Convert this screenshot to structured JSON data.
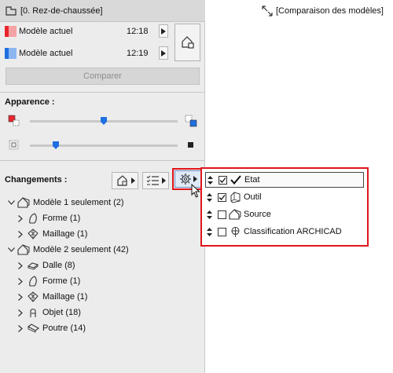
{
  "left_tab": {
    "label": "[0. Rez-de-chaussée]"
  },
  "right_tab": {
    "label": "[Comparaison des modèles]"
  },
  "models": [
    {
      "name": "Modèle actuel",
      "time": "12:18",
      "color": "#e8262c"
    },
    {
      "name": "Modèle actuel",
      "time": "12:19",
      "color": "#1f6fe0"
    }
  ],
  "compare_button": "Comparer",
  "appearance": {
    "label": "Apparence :",
    "slider1_value": 0.5,
    "slider2_value": 0.2
  },
  "changes": {
    "label": "Changements :",
    "groups": [
      {
        "label": "Modèle 1 seulement (2)",
        "items": [
          {
            "label": "Forme (1)",
            "icon": "shape-icon"
          },
          {
            "label": "Maillage (1)",
            "icon": "mesh-icon"
          }
        ]
      },
      {
        "label": "Modèle 2 seulement (42)",
        "items": [
          {
            "label": "Dalle (8)",
            "icon": "slab-icon"
          },
          {
            "label": "Forme (1)",
            "icon": "shape-icon"
          },
          {
            "label": "Maillage (1)",
            "icon": "mesh-icon"
          },
          {
            "label": "Objet (18)",
            "icon": "object-icon"
          },
          {
            "label": "Poutre (14)",
            "icon": "beam-icon"
          }
        ]
      }
    ]
  },
  "dropdown": {
    "items": [
      {
        "label": "Etat",
        "checked": true
      },
      {
        "label": "Outil",
        "checked": true
      },
      {
        "label": "Source",
        "checked": false
      },
      {
        "label": "Classification ARCHICAD",
        "checked": false
      }
    ]
  },
  "colors": {
    "highlight": "#e0151b",
    "accent_blue": "#1f6fe0",
    "accent_red": "#e8262c"
  }
}
